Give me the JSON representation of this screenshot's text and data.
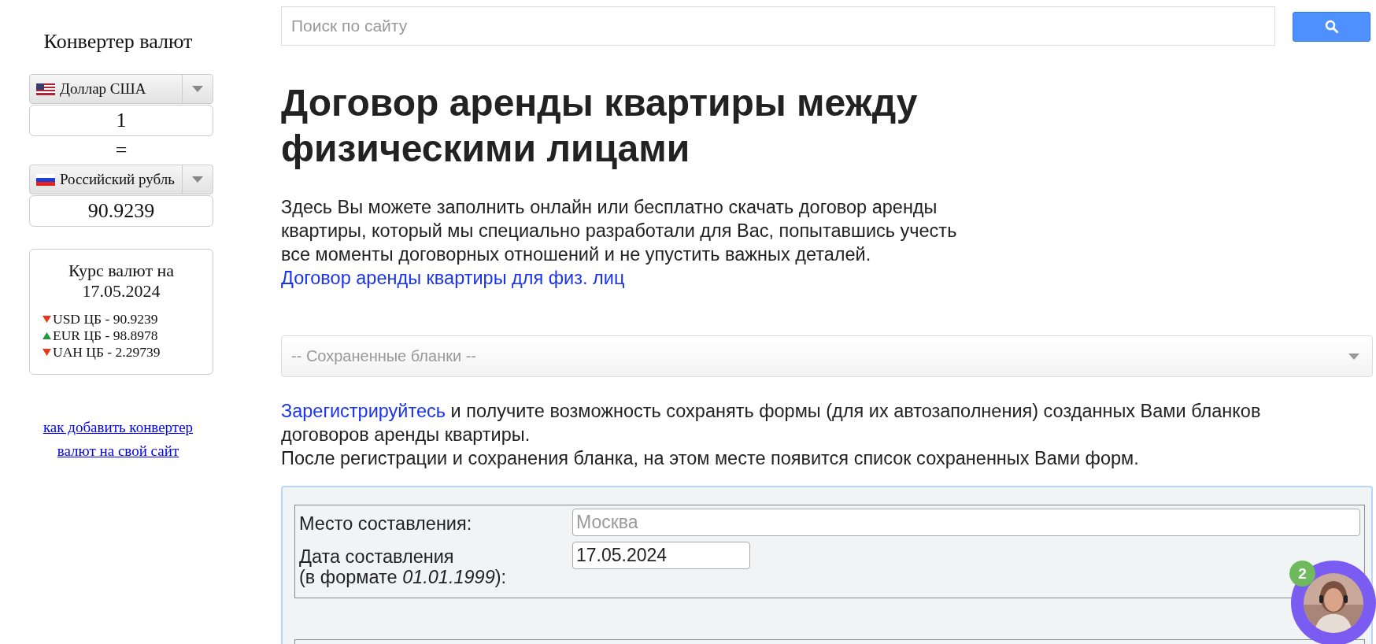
{
  "converter": {
    "title": "Конвертер валют",
    "from": {
      "currency": "Доллар США",
      "kind": "us"
    },
    "amount": "1",
    "equals": "=",
    "to": {
      "currency": "Российский рубль",
      "kind": "ru"
    },
    "result": "90.9239"
  },
  "rates": {
    "title": "Курс валют на 17.05.2024",
    "items": [
      {
        "label": "USD ЦБ - 90.9239",
        "kind": "down"
      },
      {
        "label": "EUR ЦБ - 98.8978",
        "kind": "up"
      },
      {
        "label": "UAH ЦБ - 2.29739",
        "kind": "down"
      }
    ]
  },
  "converter_link": "как добавить конвертер валют на свой сайт",
  "search": {
    "placeholder": "Поиск по сайту"
  },
  "heading": "Договор аренды квартиры между физическими лицами",
  "intro": "Здесь Вы можете заполнить онлайн или бесплатно скачать договор аренды квартиры, который мы специально разработали для Вас, попытавшись учесть все моменты договорных отношений и не упустить важных деталей.",
  "intro_link": "Договор аренды квартиры для физ. лиц",
  "saved_forms": {
    "placeholder": "-- Сохраненные бланки --"
  },
  "register": {
    "link": "Зарегистрируйтесь",
    "text": " и получите возможность сохранять формы (для их автозаполнения) созданных Вами бланков договоров аренды квартиры.",
    "note": "После регистрации и сохранения бланка, на этом месте появится список сохраненных Вами форм."
  },
  "form": {
    "fields": [
      {
        "label": "Место составления:",
        "placeholder": "Москва"
      },
      {
        "label": "Дата составления\n(в формате *01.01.1999*):",
        "value": "17.05.2024"
      }
    ]
  },
  "chat": {
    "badge": "2"
  }
}
